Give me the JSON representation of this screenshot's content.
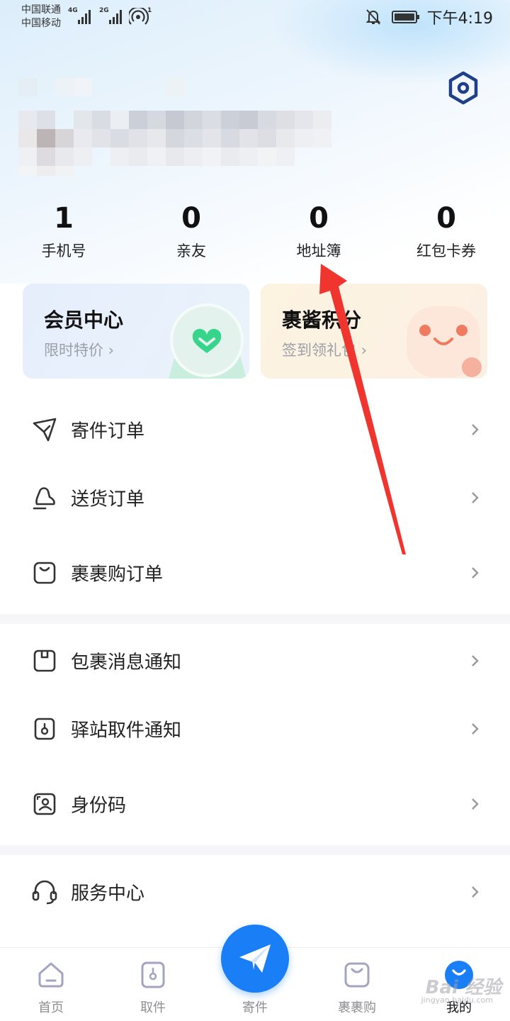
{
  "status_bar": {
    "carrier_1": "中国联通",
    "carrier_2": "中国移动",
    "net_1": "4G",
    "net_2": "2G",
    "hotspot_count": "1",
    "time": "下午4:19"
  },
  "stats": [
    {
      "value": "1",
      "label": "手机号"
    },
    {
      "value": "0",
      "label": "亲友"
    },
    {
      "value": "0",
      "label": "地址簿"
    },
    {
      "value": "0",
      "label": "红包卡券"
    }
  ],
  "promo_cards": [
    {
      "title": "会员中心",
      "subtitle": "限时特价 ›"
    },
    {
      "title": "裹酱积分",
      "subtitle": "签到领礼包 ›"
    }
  ],
  "menu": {
    "section_1": [
      {
        "label": "寄件订单",
        "icon": "paper-plane-icon"
      },
      {
        "label": "送货订单",
        "icon": "delivery-icon"
      },
      {
        "label": "裹裹购订单",
        "icon": "shopping-bag-icon"
      }
    ],
    "section_2": [
      {
        "label": "包裹消息通知",
        "icon": "package-icon"
      },
      {
        "label": "驿站取件通知",
        "icon": "station-icon"
      },
      {
        "label": "身份码",
        "icon": "id-code-icon"
      }
    ],
    "section_3": [
      {
        "label": "服务中心",
        "icon": "headset-icon"
      }
    ]
  },
  "bottom_nav": [
    {
      "label": "首页",
      "icon": "home-icon"
    },
    {
      "label": "取件",
      "icon": "pickup-icon"
    },
    {
      "label": "寄件",
      "icon": "send-icon"
    },
    {
      "label": "裹裹购",
      "icon": "bag-icon"
    },
    {
      "label": "我的",
      "icon": "profile-icon",
      "active": true
    }
  ],
  "watermark": {
    "brand": "Bai 经验",
    "url": "jingyan.baidu.com"
  },
  "colors": {
    "accent": "#1a7ef6",
    "settings": "#1f3f8a",
    "annotation_arrow": "#f0342e"
  }
}
